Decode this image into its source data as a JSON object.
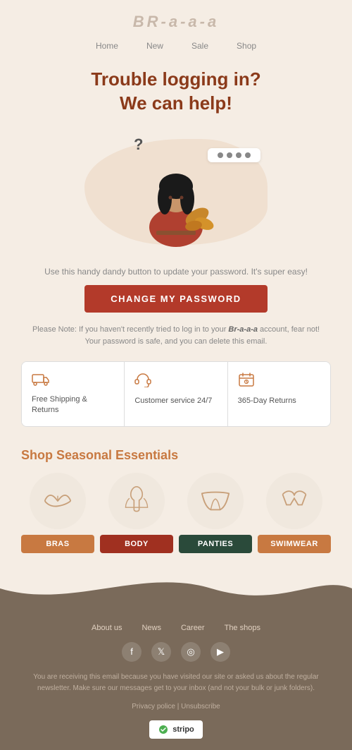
{
  "header": {
    "logo": "BR-a-a-a"
  },
  "nav": {
    "items": [
      "Home",
      "New",
      "Sale",
      "Shop"
    ]
  },
  "hero": {
    "title": "Trouble logging in?\nWe can help!"
  },
  "illustration": {
    "question_mark": "?",
    "password_dots": 4
  },
  "desc": {
    "text": "Use this handy dandy button to update your password. It's super easy!"
  },
  "cta": {
    "label": "CHANGE MY PASSWORD"
  },
  "note": {
    "text": "Please Note: If you haven't recently tried to log in to your Br-a-a-a account, fear not! Your password is safe, and you can delete this email."
  },
  "features": [
    {
      "icon": "truck",
      "label": "Free Shipping & Returns"
    },
    {
      "icon": "headset",
      "label": "Customer service 24/7"
    },
    {
      "icon": "calendar",
      "label": "365-Day Returns"
    }
  ],
  "shop_section": {
    "title": "Shop Seasonal Essentials",
    "items": [
      {
        "label": "BRAS",
        "btn_class": "btn-bras"
      },
      {
        "label": "BODY",
        "btn_class": "btn-body"
      },
      {
        "label": "PANTIES",
        "btn_class": "btn-panties"
      },
      {
        "label": "SWIMWEAR",
        "btn_class": "btn-swimwear"
      }
    ]
  },
  "footer": {
    "nav": [
      "About us",
      "News",
      "Career",
      "The shops"
    ],
    "disclaimer": "You are receiving this email because you have visited our site or asked us about the regular newsletter. Make sure our messages get to your inbox (and not your bulk or junk folders).",
    "privacy_link": "Privacy police",
    "unsubscribe_link": "Unsubscribe",
    "stripo_label": "stripo"
  }
}
